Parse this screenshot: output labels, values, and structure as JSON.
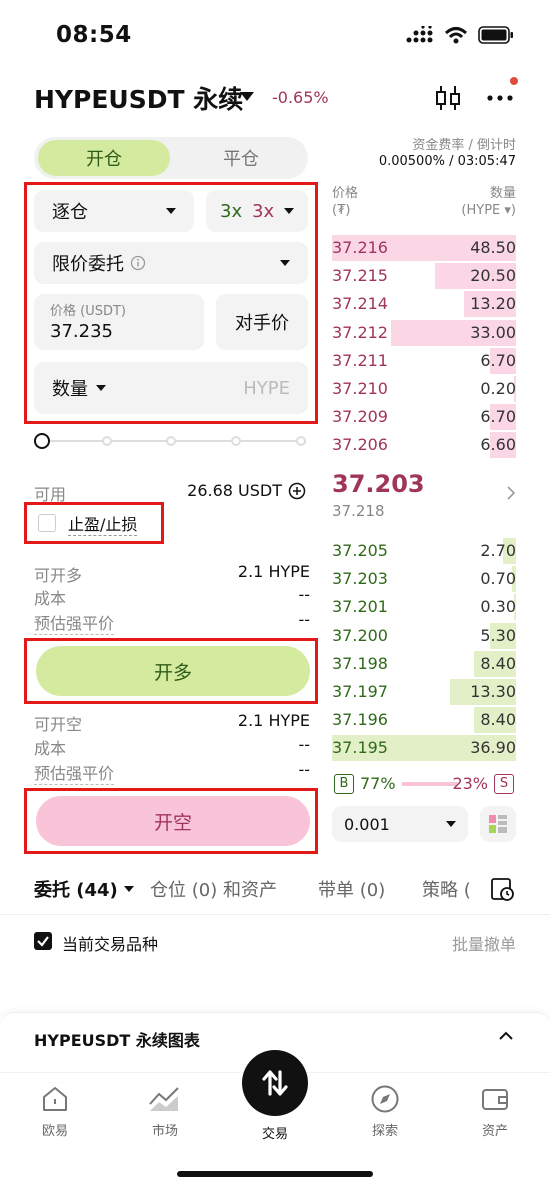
{
  "status": {
    "time": "08:54"
  },
  "header": {
    "pair": "HYPEUSDT 永续",
    "change": "-0.65%",
    "funding_label": "资金费率 / 倒计时",
    "funding_value": "0.00500% / 03:05:47"
  },
  "toggle": {
    "open": "开仓",
    "close": "平仓"
  },
  "form": {
    "margin_mode": "逐仓",
    "leverage_long": "3x",
    "leverage_short": "3x",
    "order_type": "限价委托",
    "price_label": "价格 (USDT)",
    "price_value": "37.235",
    "counterparty_button": "对手价",
    "qty_label": "数量",
    "qty_unit": "HYPE"
  },
  "available": {
    "label": "可用",
    "value": "26.68 USDT"
  },
  "tpsl": {
    "label": "止盈/止损",
    "checked": false
  },
  "long_info": {
    "can_open_label": "可开多",
    "can_open_value": "2.1 HYPE",
    "cost_label": "成本",
    "cost_value": "--",
    "liq_label": "预估强平价",
    "liq_value": "--",
    "button": "开多"
  },
  "short_info": {
    "can_open_label": "可开空",
    "can_open_value": "2.1 HYPE",
    "cost_label": "成本",
    "cost_value": "--",
    "liq_label": "预估强平价",
    "liq_value": "--",
    "button": "开空"
  },
  "orderbook": {
    "price_label": "价格",
    "price_unit": "(₮)",
    "qty_label": "数量",
    "qty_unit": "(HYPE ▾)",
    "asks": [
      {
        "price": "37.216",
        "qty": "48.50",
        "depth": 1.0
      },
      {
        "price": "37.215",
        "qty": "20.50",
        "depth": 0.44
      },
      {
        "price": "37.214",
        "qty": "13.20",
        "depth": 0.28
      },
      {
        "price": "37.212",
        "qty": "33.00",
        "depth": 0.68
      },
      {
        "price": "37.211",
        "qty": "6.70",
        "depth": 0.14
      },
      {
        "price": "37.210",
        "qty": "0.20",
        "depth": 0.01
      },
      {
        "price": "37.209",
        "qty": "6.70",
        "depth": 0.14
      },
      {
        "price": "37.206",
        "qty": "6.60",
        "depth": 0.14
      }
    ],
    "last_price": "37.203",
    "mark_price": "37.218",
    "bids": [
      {
        "price": "37.205",
        "qty": "2.70",
        "depth": 0.07
      },
      {
        "price": "37.203",
        "qty": "0.70",
        "depth": 0.02
      },
      {
        "price": "37.201",
        "qty": "0.30",
        "depth": 0.01
      },
      {
        "price": "37.200",
        "qty": "5.30",
        "depth": 0.14
      },
      {
        "price": "37.198",
        "qty": "8.40",
        "depth": 0.23
      },
      {
        "price": "37.197",
        "qty": "13.30",
        "depth": 0.36
      },
      {
        "price": "37.196",
        "qty": "8.40",
        "depth": 0.23
      },
      {
        "price": "37.195",
        "qty": "36.90",
        "depth": 1.0
      }
    ],
    "buy_tag": "B",
    "buy_pct": "77%",
    "sell_pct": "23%",
    "sell_tag": "S",
    "precision": "0.001"
  },
  "tabs": [
    "委托 (44)",
    "仓位 (0) 和资产",
    "带单 (0)",
    "策略 ("
  ],
  "filter": {
    "current_pair": "当前交易品种",
    "batch_cancel": "批量撤单"
  },
  "chart_panel": {
    "title": "HYPEUSDT 永续图表"
  },
  "nav": [
    "欧易",
    "市场",
    "交易",
    "探索",
    "资产"
  ],
  "colors": {
    "long": "#d4ea9e",
    "short": "#f9c3d8",
    "ask_text": "#a0355a",
    "bid_text": "#2f6a1a"
  }
}
